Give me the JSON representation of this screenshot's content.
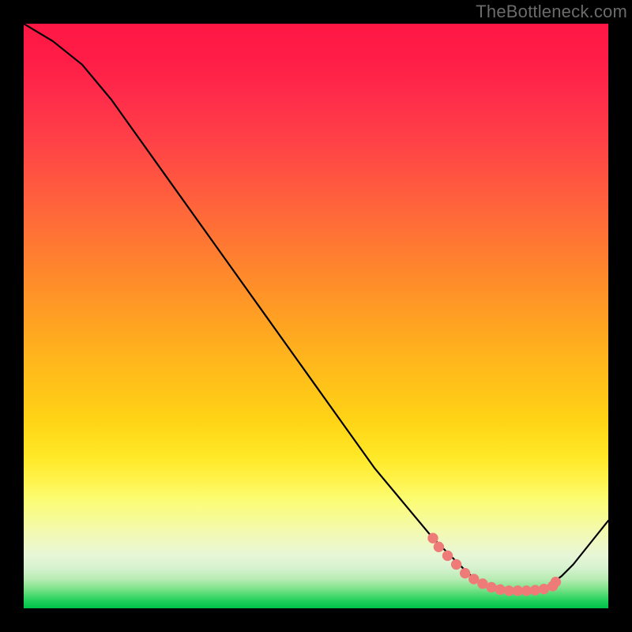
{
  "watermark": "TheBottleneck.com",
  "chart_data": {
    "type": "line",
    "title": "",
    "xlabel": "",
    "ylabel": "",
    "xlim": [
      0,
      100
    ],
    "ylim": [
      0,
      100
    ],
    "series": [
      {
        "name": "curve",
        "x": [
          0,
          5,
          10,
          15,
          20,
          25,
          30,
          35,
          40,
          45,
          50,
          55,
          60,
          65,
          70,
          72,
          74,
          76,
          78,
          80,
          82,
          84,
          86,
          88,
          90,
          92,
          94,
          96,
          98,
          100
        ],
        "y": [
          100,
          97,
          93,
          87,
          80,
          73,
          66,
          59,
          52,
          45,
          38,
          31,
          24,
          18,
          12,
          10,
          8,
          6,
          4.5,
          3.5,
          3,
          3,
          3,
          3.2,
          4,
          5.5,
          7.5,
          10,
          12.5,
          15
        ]
      },
      {
        "name": "dots",
        "x": [
          70,
          71,
          72.5,
          74,
          75.5,
          77,
          78.5,
          80,
          81.5,
          83,
          84.5,
          86,
          87.5,
          89,
          90.5,
          91
        ],
        "y": [
          12,
          10.5,
          9,
          7.5,
          6,
          5,
          4.2,
          3.6,
          3.2,
          3,
          3,
          3,
          3.1,
          3.3,
          3.8,
          4.5
        ]
      }
    ],
    "background": {
      "type": "vertical-gradient",
      "stops": [
        {
          "pos": 0.0,
          "color": "#ff1744"
        },
        {
          "pos": 0.5,
          "color": "#ffb020"
        },
        {
          "pos": 0.78,
          "color": "#fff24a"
        },
        {
          "pos": 0.92,
          "color": "#d7f2d0"
        },
        {
          "pos": 1.0,
          "color": "#00c14a"
        }
      ]
    }
  }
}
